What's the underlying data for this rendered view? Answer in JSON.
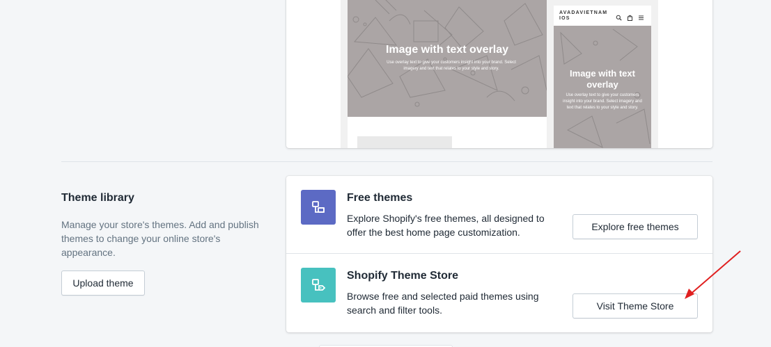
{
  "preview": {
    "desktop": {
      "hero_title": "Image with text overlay",
      "hero_text": "Use overlay text to give your customers insight into your brand. Select imagery and text that relates to your style and story."
    },
    "mobile": {
      "brand": "AVADAVIETNAMIOS",
      "hero_title": "Image with text overlay",
      "hero_text": "Use overlay text to give your customers insight into your brand. Select imagery and text that relates to your style and story.",
      "icons": [
        "search-icon",
        "bag-icon",
        "menu-icon"
      ]
    }
  },
  "theme_library": {
    "title": "Theme library",
    "description": "Manage your store's themes. Add and publish themes to change your online store's appearance.",
    "upload_label": "Upload theme",
    "options": [
      {
        "title": "Free themes",
        "description": "Explore Shopify's free themes, all designed to offer the best home page customization.",
        "button_label": "Explore free themes",
        "icon": "theme-icon",
        "icon_color": "#5c6ac4"
      },
      {
        "title": "Shopify Theme Store",
        "description": "Browse free and selected paid themes using search and filter tools.",
        "button_label": "Visit Theme Store",
        "icon": "theme-store-icon",
        "icon_color": "#47c1bf"
      }
    ]
  },
  "colors": {
    "background": "#f4f6f8",
    "annotation_arrow": "#e02020"
  }
}
